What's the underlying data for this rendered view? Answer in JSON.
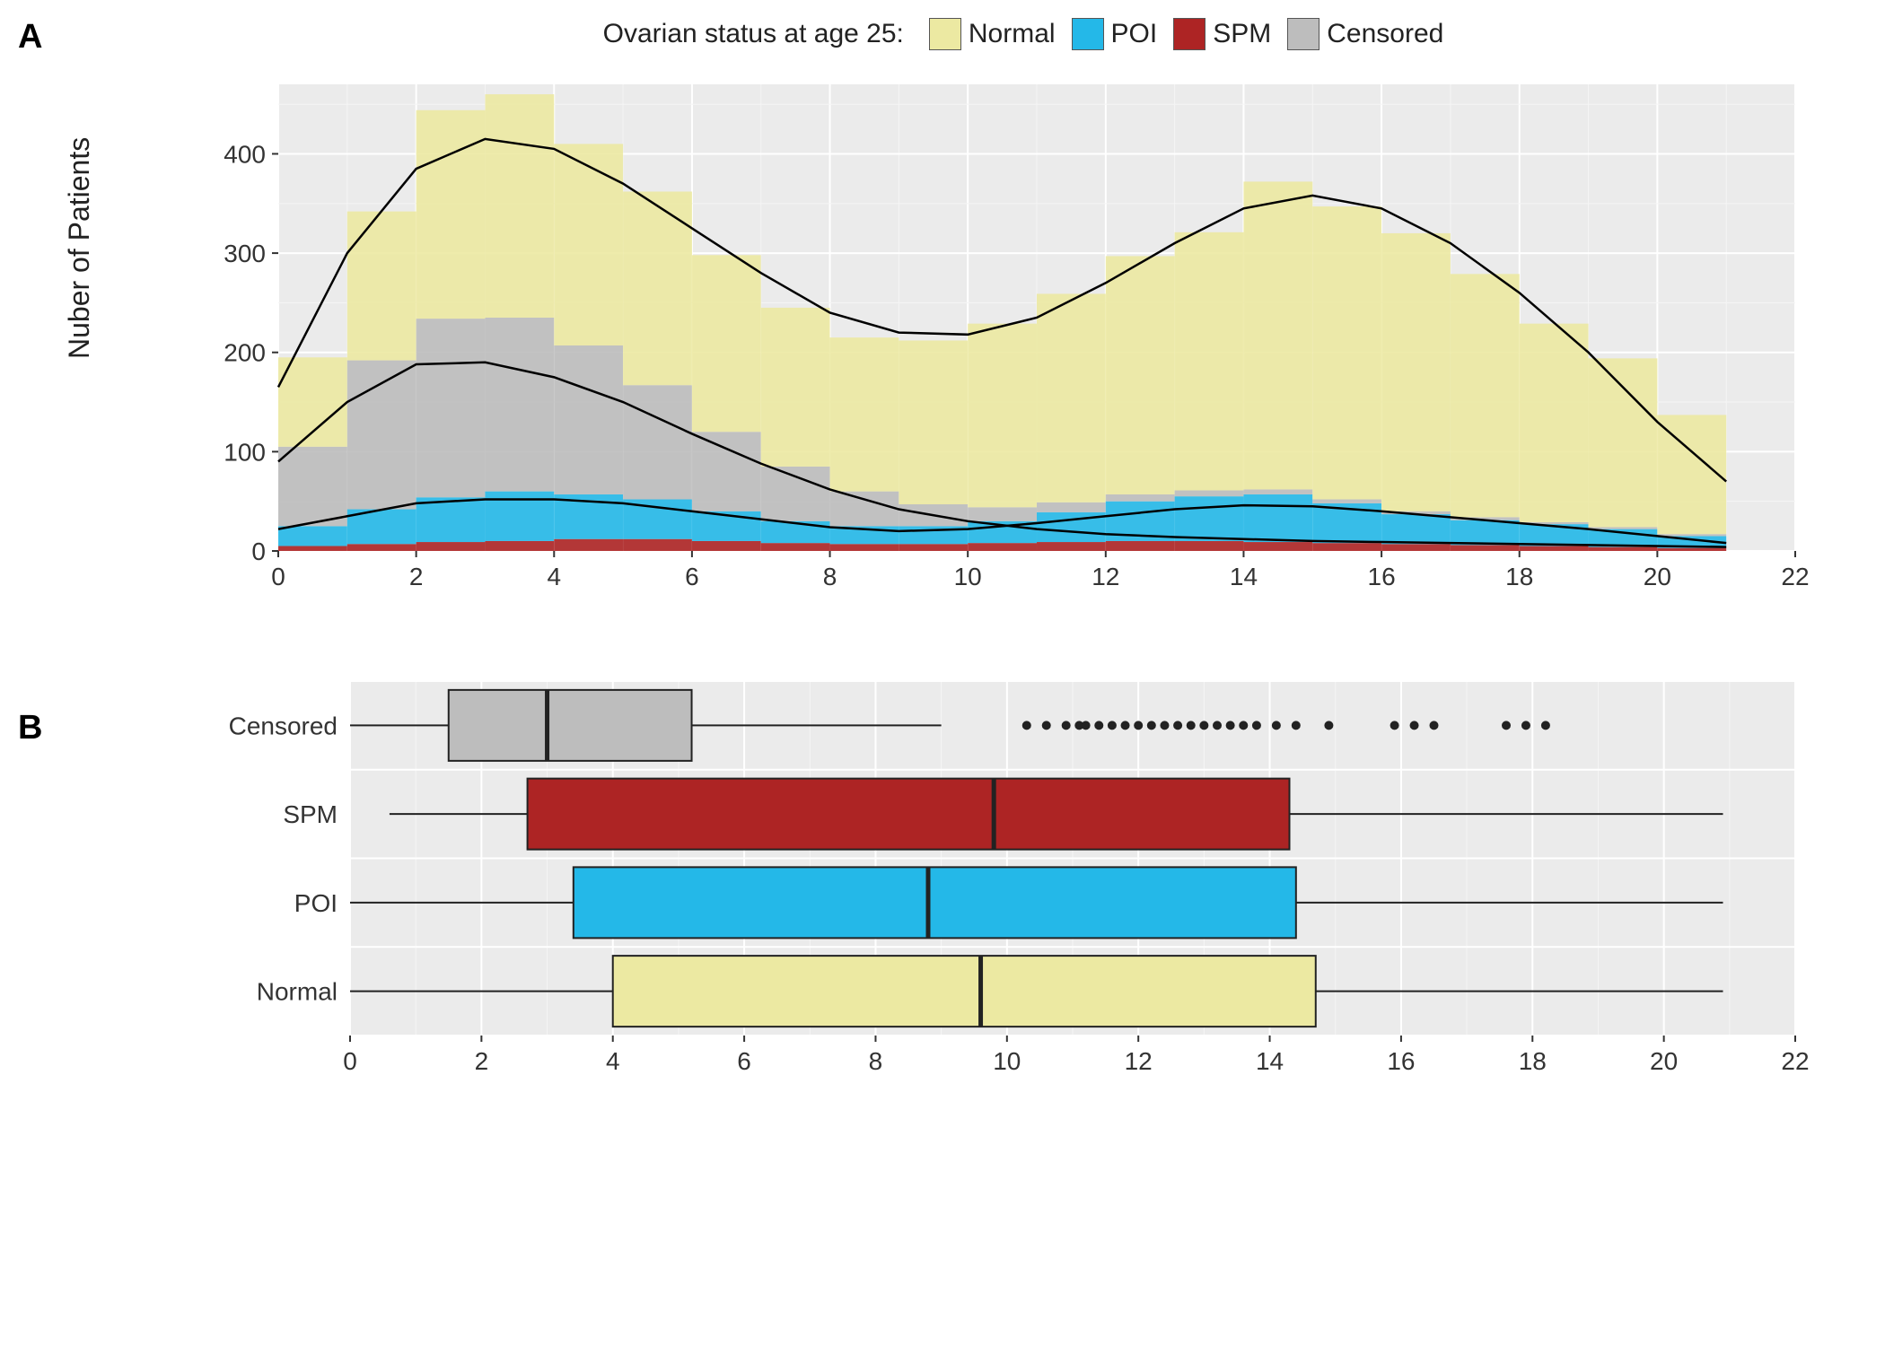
{
  "legend": {
    "title": "Ovarian status at age 25:",
    "items": [
      {
        "label": "Normal",
        "color": "#ece9a2"
      },
      {
        "label": "POI",
        "color": "#24b8e8"
      },
      {
        "label": "SPM",
        "color": "#ad2424"
      },
      {
        "label": "Censored",
        "color": "#bdbdbd"
      }
    ]
  },
  "panelA": {
    "label": "A",
    "ylabel": "Nuber of Patients",
    "xlim": [
      0,
      22
    ],
    "ylim": [
      0,
      470
    ],
    "xticks": [
      0,
      2,
      4,
      6,
      8,
      10,
      12,
      14,
      16,
      18,
      20,
      22
    ],
    "yticks": [
      0,
      100,
      200,
      300,
      400
    ]
  },
  "panelB": {
    "label": "B",
    "xlim": [
      0,
      22
    ],
    "xticks": [
      0,
      2,
      4,
      6,
      8,
      10,
      12,
      14,
      16,
      18,
      20,
      22
    ],
    "categories": [
      "Censored",
      "SPM",
      "POI",
      "Normal"
    ]
  },
  "chart_data": [
    {
      "type": "bar",
      "panel": "A",
      "note": "stacked histogram, bin width 1 (x = left edge)",
      "title": "",
      "xlabel": "",
      "ylabel": "Nuber of Patients",
      "xlim": [
        0,
        22
      ],
      "ylim": [
        0,
        470
      ],
      "categories": [
        0,
        1,
        2,
        3,
        4,
        5,
        6,
        7,
        8,
        9,
        10,
        11,
        12,
        13,
        14,
        15,
        16,
        17,
        18,
        19,
        20
      ],
      "series": [
        {
          "name": "SPM",
          "values": [
            5,
            7,
            9,
            10,
            12,
            12,
            10,
            8,
            7,
            7,
            8,
            9,
            10,
            10,
            9,
            8,
            7,
            6,
            5,
            4,
            3
          ]
        },
        {
          "name": "POI",
          "values": [
            20,
            35,
            45,
            50,
            45,
            40,
            30,
            22,
            18,
            18,
            22,
            30,
            40,
            45,
            48,
            40,
            30,
            25,
            22,
            18,
            12
          ]
        },
        {
          "name": "Censored",
          "values": [
            80,
            150,
            180,
            175,
            150,
            115,
            80,
            55,
            35,
            22,
            14,
            10,
            7,
            6,
            5,
            4,
            3,
            3,
            2,
            2,
            2
          ]
        },
        {
          "name": "Normal",
          "values": [
            90,
            150,
            210,
            225,
            203,
            195,
            178,
            160,
            155,
            165,
            185,
            210,
            240,
            260,
            310,
            295,
            280,
            245,
            200,
            170,
            120
          ]
        }
      ],
      "density_curves_approx": {
        "note": "three overlaid smoothed density lines (black) tracing Normal-top, Censored-top, POI-top",
        "normal_top": [
          165,
          300,
          385,
          415,
          405,
          370,
          325,
          280,
          240,
          220,
          218,
          235,
          270,
          310,
          345,
          358,
          345,
          310,
          260,
          200,
          130,
          70
        ],
        "censored_top": [
          90,
          150,
          188,
          190,
          175,
          150,
          118,
          88,
          62,
          42,
          30,
          22,
          17,
          14,
          12,
          10,
          9,
          8,
          7,
          6,
          5,
          4
        ],
        "poi_top": [
          22,
          35,
          48,
          52,
          52,
          48,
          40,
          32,
          24,
          20,
          22,
          28,
          35,
          42,
          46,
          45,
          40,
          34,
          28,
          22,
          15,
          8
        ]
      }
    },
    {
      "type": "box",
      "panel": "B",
      "title": "",
      "xlabel": "",
      "ylabel": "",
      "xlim": [
        0,
        22
      ],
      "orientation": "horizontal",
      "series": [
        {
          "name": "Censored",
          "color": "#bdbdbd",
          "whisker_low": 0.0,
          "q1": 1.5,
          "median": 3.0,
          "q3": 5.2,
          "whisker_high": 9.0,
          "outliers": [
            10.3,
            10.6,
            10.9,
            11.1,
            11.2,
            11.4,
            11.6,
            11.8,
            12.0,
            12.2,
            12.4,
            12.6,
            12.8,
            13.0,
            13.2,
            13.4,
            13.6,
            13.8,
            14.1,
            14.4,
            14.9,
            15.9,
            16.2,
            16.5,
            17.6,
            17.9,
            18.2
          ]
        },
        {
          "name": "SPM",
          "color": "#ad2424",
          "whisker_low": 0.6,
          "q1": 2.7,
          "median": 9.8,
          "q3": 14.3,
          "whisker_high": 20.9,
          "outliers": []
        },
        {
          "name": "POI",
          "color": "#24b8e8",
          "whisker_low": 0.0,
          "q1": 3.4,
          "median": 8.8,
          "q3": 14.4,
          "whisker_high": 20.9,
          "outliers": []
        },
        {
          "name": "Normal",
          "color": "#ece9a2",
          "whisker_low": 0.0,
          "q1": 4.0,
          "median": 9.6,
          "q3": 14.7,
          "whisker_high": 20.9,
          "outliers": []
        }
      ]
    }
  ]
}
